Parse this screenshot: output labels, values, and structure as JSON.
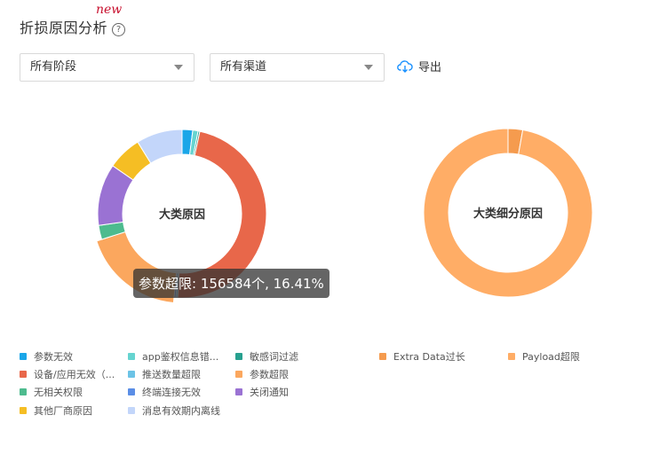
{
  "header": {
    "title": "折损原因分析",
    "new_badge": "new",
    "help_icon": "?"
  },
  "filters": {
    "stage": "所有阶段",
    "channel": "所有渠道"
  },
  "export_label": "导出",
  "tooltip": {
    "text": "参数超限: 156584个, 16.41%"
  },
  "chart_data": [
    {
      "type": "pie",
      "center_label": "大类原因",
      "slices": [
        {
          "name": "参数无效",
          "value": 1.8,
          "color": "#1aa6e8"
        },
        {
          "name": "app鉴权信息错...",
          "value": 0.9,
          "color": "#66d4d0"
        },
        {
          "name": "敏感词过滤",
          "value": 0.3,
          "color": "#27a08f"
        },
        {
          "name": "设备/应用无效（...",
          "value": 42.0,
          "color": "#e8674a"
        },
        {
          "name": "推送数量超限",
          "value": 0.3,
          "color": "#6cc3e6"
        },
        {
          "name": "终端连接无效",
          "value": 0.3,
          "color": "#5b8ee6"
        },
        {
          "name": "参数超限",
          "value": 16.41,
          "color": "#fba75e"
        },
        {
          "name": "无相关权限",
          "value": 2.4,
          "color": "#4dbb8e"
        },
        {
          "name": "关闭通知",
          "value": 10.5,
          "color": "#9a72d3"
        },
        {
          "name": "其他厂商原因",
          "value": 5.8,
          "color": "#f5be24"
        },
        {
          "name": "消息有效期内离线",
          "value": 7.8,
          "color": "#c3d6fa"
        }
      ]
    },
    {
      "type": "pie",
      "center_label": "大类细分原因",
      "slices": [
        {
          "name": "Extra Data过长",
          "value": 2.8,
          "color": "#f59b4e"
        },
        {
          "name": "Payload超限",
          "value": 97.2,
          "color": "#ffad66"
        }
      ]
    }
  ],
  "legend": [
    {
      "label": "参数无效",
      "color": "#1aa6e8"
    },
    {
      "label": "app鉴权信息错...",
      "color": "#66d4d0"
    },
    {
      "label": "敏感词过滤",
      "color": "#27a08f"
    },
    {
      "label": "设备/应用无效（...",
      "color": "#e8674a"
    },
    {
      "label": "推送数量超限",
      "color": "#6cc3e6"
    },
    {
      "label": "参数超限",
      "color": "#fba75e"
    },
    {
      "label": "无相关权限",
      "color": "#4dbb8e"
    },
    {
      "label": "终端连接无效",
      "color": "#5b8ee6"
    },
    {
      "label": "关闭通知",
      "color": "#9a72d3"
    },
    {
      "label": "其他厂商原因",
      "color": "#f5be24"
    },
    {
      "label": "消息有效期内离线",
      "color": "#c3d6fa"
    },
    {
      "label": "Extra Data过长",
      "color": "#f59b4e"
    },
    {
      "label": "Payload超限",
      "color": "#ffad66"
    }
  ]
}
